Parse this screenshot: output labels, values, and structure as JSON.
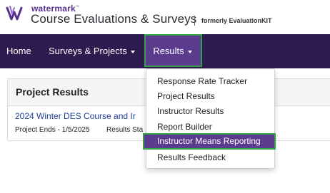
{
  "brand": {
    "company": "watermark",
    "trademark": "™",
    "product": "Course Evaluations & Surveys",
    "formerly": "formerly EvaluationKIT"
  },
  "nav": {
    "home": "Home",
    "surveys": "Surveys & Projects",
    "results": "Results"
  },
  "dropdown": {
    "items": [
      "Response Rate Tracker",
      "Project Results",
      "Instructor Results",
      "Report Builder",
      "Instructor Means Reporting",
      "Results Feedback"
    ]
  },
  "panel": {
    "title": "Project Results",
    "project_name": "2024 Winter DES Course and Ir",
    "project_ends": "Project Ends - 1/5/2025",
    "results_status": "Results Sta"
  },
  "colors": {
    "nav_bg": "#2e1b4f",
    "active_bg": "#5a3b8e",
    "highlight_border": "#35a047",
    "brand_purple": "#5a2f91"
  }
}
